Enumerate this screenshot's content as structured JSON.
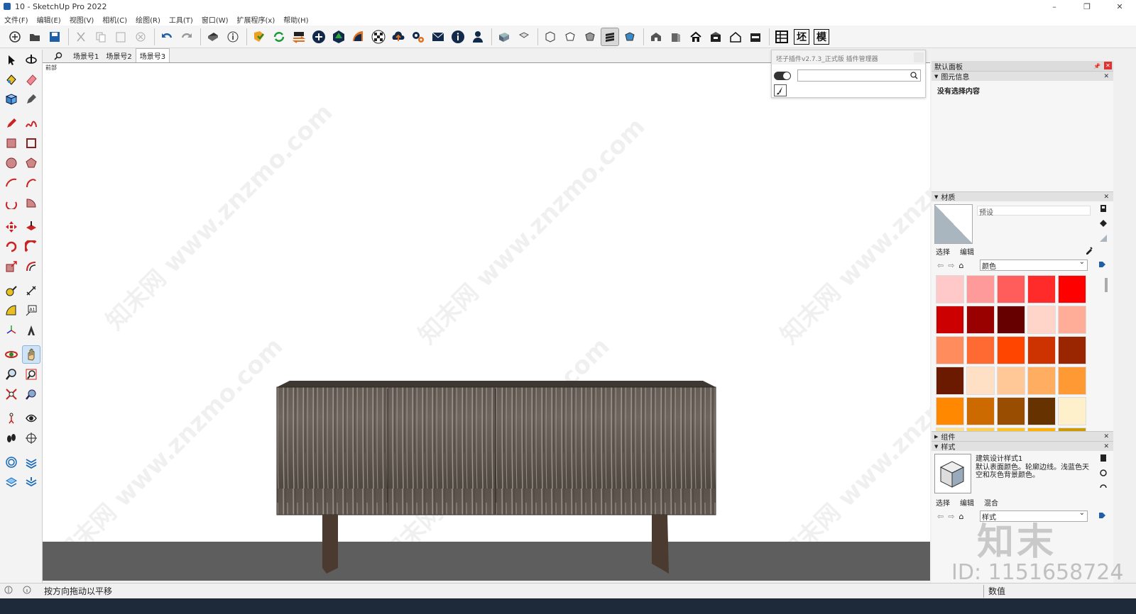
{
  "window": {
    "title": "10 - SketchUp Pro 2022",
    "controls": [
      "–",
      "❐",
      "✕"
    ]
  },
  "menu": [
    "文件(F)",
    "编辑(E)",
    "视图(V)",
    "相机(C)",
    "绘图(R)",
    "工具(T)",
    "窗口(W)",
    "扩展程序(x)",
    "帮助(H)"
  ],
  "toolbar": {
    "text_buttons": [
      "坯",
      "模"
    ]
  },
  "scenes": {
    "tabs": [
      "场景号1",
      "场景号2",
      "场景号3"
    ],
    "active_index": 2
  },
  "viewport": {
    "view_label": "前部",
    "watermark": "知末网 www.znzmo.com"
  },
  "plugin": {
    "title": "坯子插件v2.7.3_正式版 插件管理器",
    "search_placeholder": ""
  },
  "right_panel": {
    "title": "默认面板",
    "entity_info": {
      "header": "图元信息",
      "content": "没有选择内容"
    },
    "materials": {
      "header": "材质",
      "current_name": "预设",
      "tabs": [
        "选择",
        "编辑"
      ],
      "collection": "颜色",
      "swatches": [
        "#ffc9c9",
        "#ff9a9a",
        "#ff5c5c",
        "#ff2a2a",
        "#ff0000",
        "#cc0000",
        "#990000",
        "#660000",
        "#ffd4c9",
        "#ffac98",
        "#ff8c5c",
        "#ff6a33",
        "#ff4500",
        "#cc3300",
        "#992600",
        "#6b1a00",
        "#ffe0c4",
        "#ffc896",
        "#ffad60",
        "#ff9933",
        "#ff8800",
        "#cc6a00",
        "#994d00",
        "#663300",
        "#fff0cc",
        "#ffe08a",
        "#ffd04f",
        "#ffc21f",
        "#ffb000",
        "#cc9a00"
      ]
    },
    "components": {
      "header": "组件"
    },
    "styles": {
      "header": "样式",
      "name": "建筑设计样式1",
      "description": "默认表面颜色。轮廓边线。浅蓝色天空和灰色背景颜色。",
      "tabs": [
        "选择",
        "编辑",
        "混合"
      ],
      "collection": "样式"
    }
  },
  "status": {
    "message": "按方向拖动以平移",
    "measure_label": "数值"
  },
  "overlay": {
    "id_text": "ID: 1151658724",
    "logo": "知末"
  },
  "colors": {
    "ground": "#5e5e5e",
    "cabinet_top": "#6f665c",
    "cabinet_leg": "#4a3a30"
  }
}
